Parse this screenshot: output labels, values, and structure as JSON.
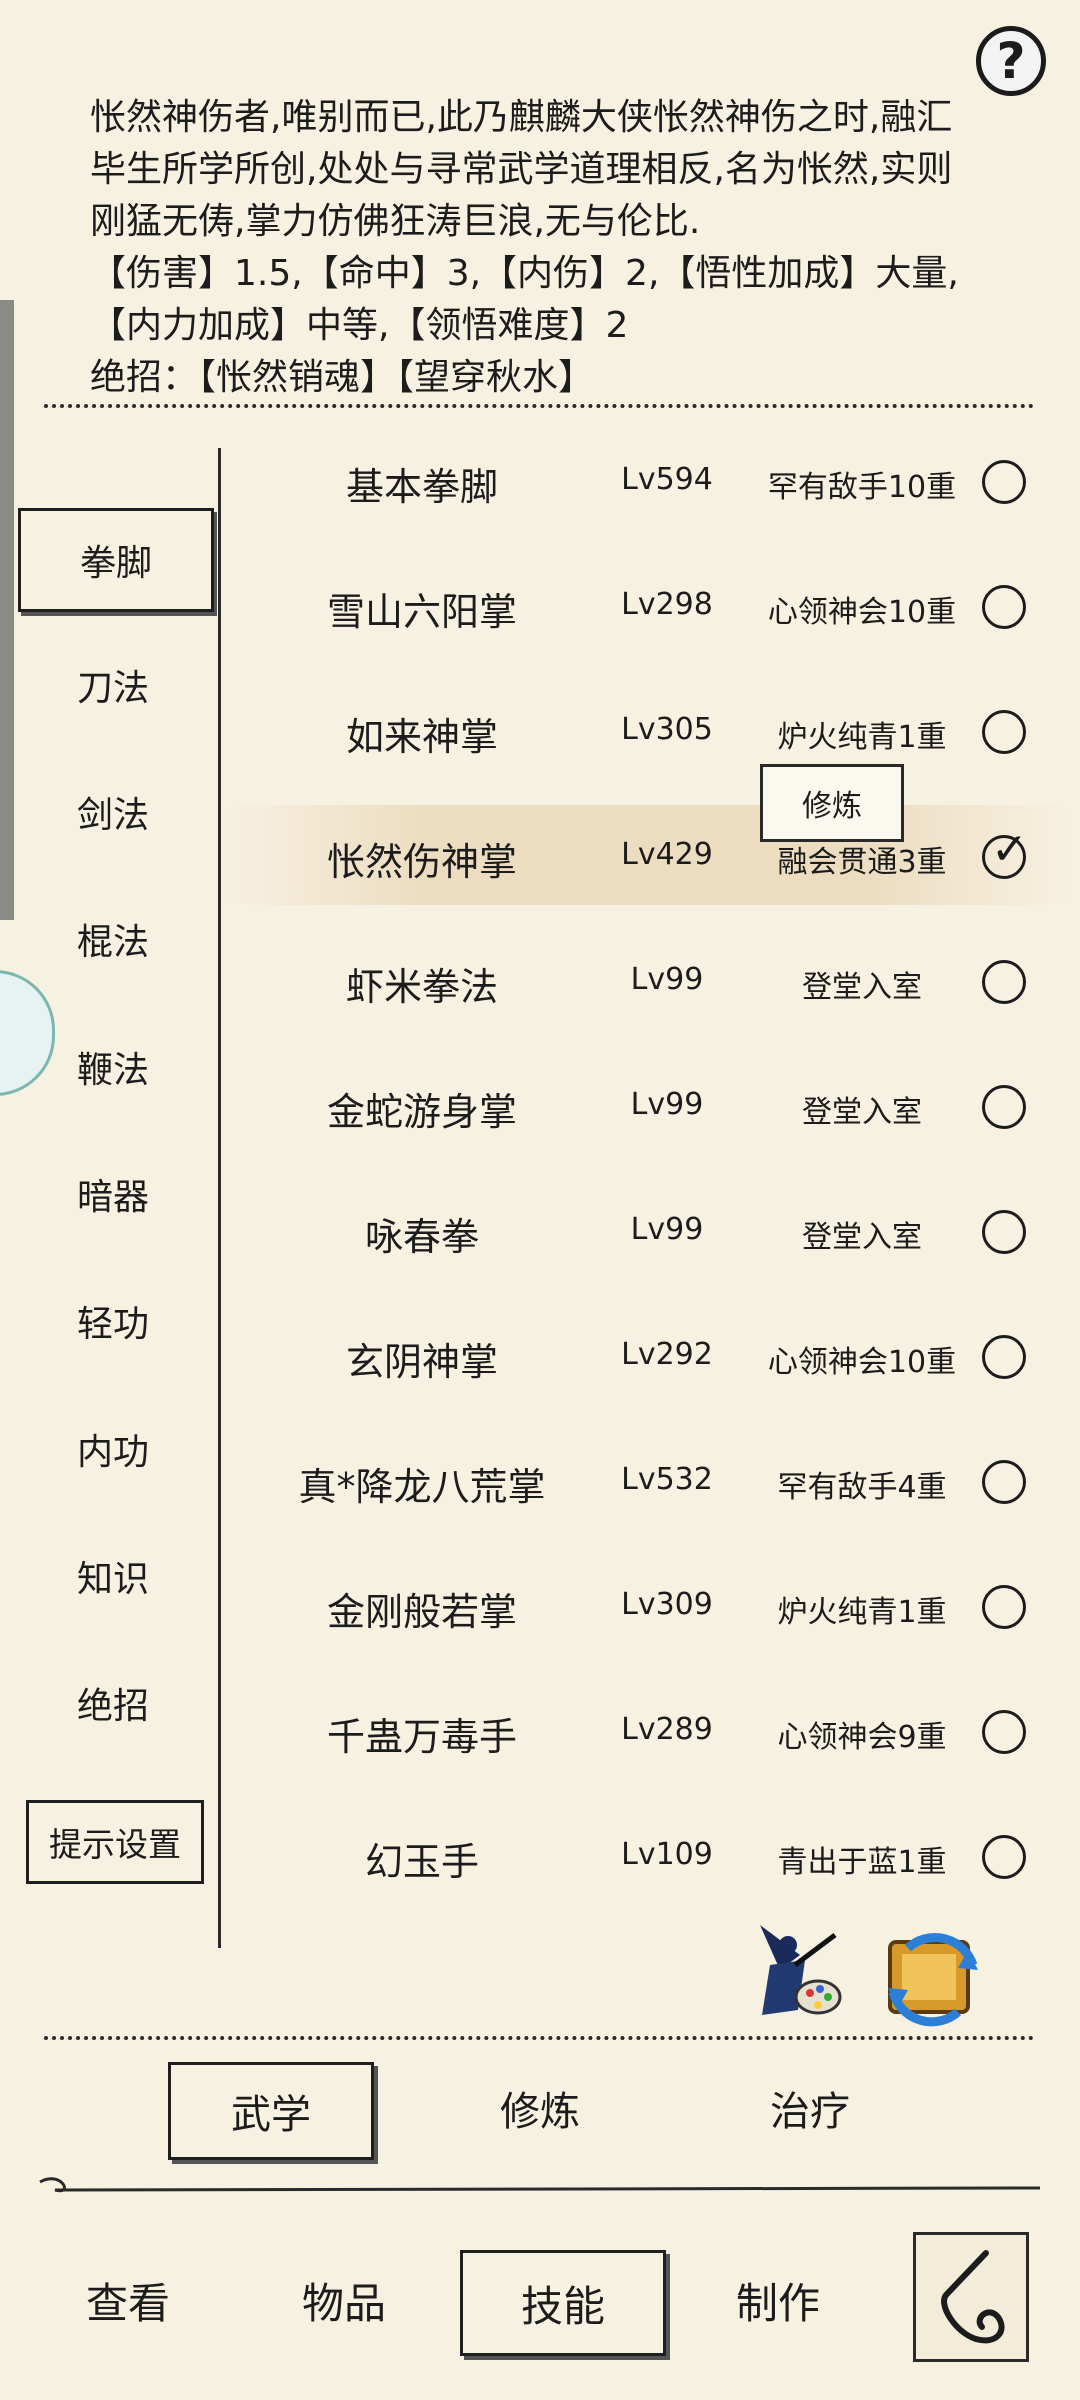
{
  "description": {
    "lines": [
      "怅然神伤者,唯别而已,此乃麒麟大侠怅然神伤之时,融汇",
      "毕生所学所创,处处与寻常武学道理相反,名为怅然,实则",
      "刚猛无俦,掌力仿佛狂涛巨浪,无与伦比.",
      "【伤害】1.5,【命中】3,【内伤】2,【悟性加成】大量,",
      "【内力加成】中等,【领悟难度】2",
      "绝招：【怅然销魂】【望穿秋水】"
    ]
  },
  "help_label": "?",
  "categories": [
    "拳脚",
    "刀法",
    "剑法",
    "棍法",
    "鞭法",
    "暗器",
    "轻功",
    "内功",
    "知识",
    "绝招"
  ],
  "hint_settings_label": "提示设置",
  "skills": [
    {
      "name": "基本拳脚",
      "level": "Lv594",
      "stage": "罕有敌手10重",
      "checked": false
    },
    {
      "name": "雪山六阳掌",
      "level": "Lv298",
      "stage": "心领神会10重",
      "checked": false
    },
    {
      "name": "如来神掌",
      "level": "Lv305",
      "stage": "炉火纯青1重",
      "checked": false
    },
    {
      "name": "怅然伤神掌",
      "level": "Lv429",
      "stage": "融会贯通3重",
      "checked": true
    },
    {
      "name": "虾米拳法",
      "level": "Lv99",
      "stage": "登堂入室",
      "checked": false
    },
    {
      "name": "金蛇游身掌",
      "level": "Lv99",
      "stage": "登堂入室",
      "checked": false
    },
    {
      "name": "咏春拳",
      "level": "Lv99",
      "stage": "登堂入室",
      "checked": false
    },
    {
      "name": "玄阴神掌",
      "level": "Lv292",
      "stage": "心领神会10重",
      "checked": false
    },
    {
      "name": "真*降龙八荒掌",
      "level": "Lv532",
      "stage": "罕有敌手4重",
      "checked": false
    },
    {
      "name": "金刚般若掌",
      "level": "Lv309",
      "stage": "炉火纯青1重",
      "checked": false
    },
    {
      "name": "千蛊万毒手",
      "level": "Lv289",
      "stage": "心领神会9重",
      "checked": false
    },
    {
      "name": "幻玉手",
      "level": "Lv109",
      "stage": "青出于蓝1重",
      "checked": false
    }
  ],
  "tooltip_label": "修炼",
  "tabs": [
    "武学",
    "修炼",
    "治疗"
  ],
  "nav": [
    "查看",
    "物品",
    "技能",
    "制作"
  ]
}
